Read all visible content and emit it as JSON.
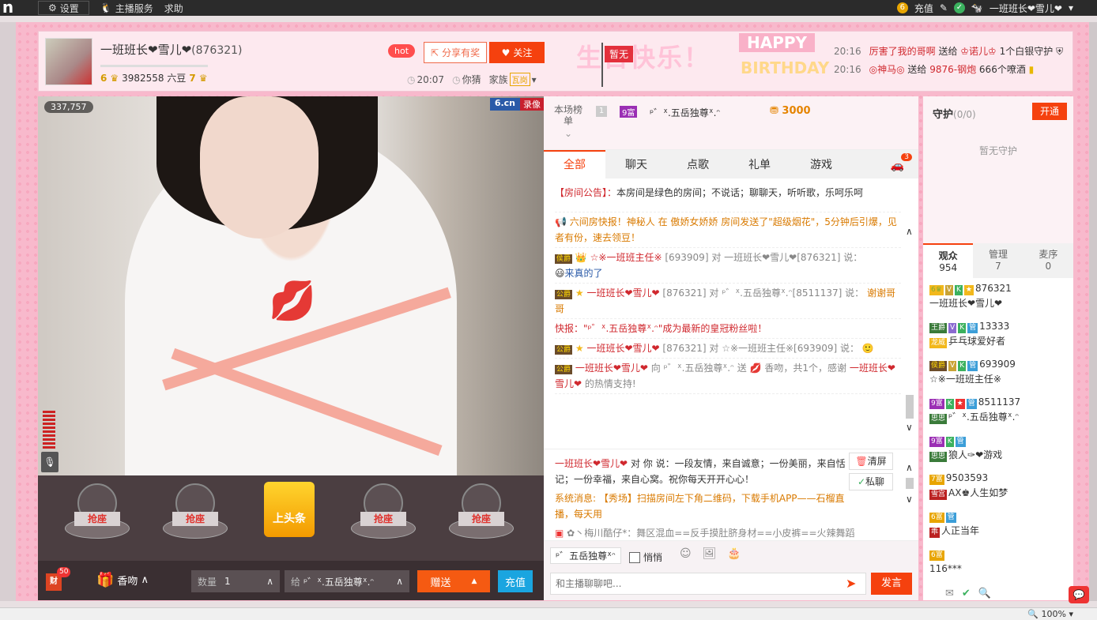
{
  "topbar": {
    "logo": "n",
    "settings": "设置",
    "anchor_service": "主播服务",
    "help": "求助",
    "coin_badge": "6",
    "recharge": "充值",
    "username": "一班班长❤雪儿❤"
  },
  "header": {
    "anchor_name": "一班班长❤雪儿❤",
    "anchor_id": "(876321)",
    "level_left": "6",
    "beans": "3982558 六豆",
    "level_right": "7",
    "hot": "hot",
    "share": "分享有奖",
    "follow": "关注",
    "time": "20:07",
    "guess": "你猜",
    "family_label": "家族",
    "family_badge": "瓦岗",
    "birthday_zh": "生日快乐！",
    "birthday_en1": "HAPPY",
    "birthday_en2": "BIRTHDAY",
    "flag": "暂无",
    "notices": [
      {
        "time": "20:16",
        "from": "厉害了我的哥啊",
        "verb": "送给",
        "to": "♔诺儿♔",
        "gift": "1个白银守护"
      },
      {
        "time": "20:16",
        "from": "◎神马◎",
        "verb": "送给",
        "to": "9876-钢炮",
        "gift": "666个嘹酒"
      }
    ]
  },
  "video": {
    "viewer_count": "337,757",
    "logo": "6.cn",
    "record": "录像"
  },
  "seats": {
    "grab": "抢座",
    "headline": "上头条"
  },
  "bottombar": {
    "gift_badge": "财",
    "gift_count": "50",
    "gift_name": "香吻",
    "qty_label": "数量",
    "qty_value": "1",
    "to_label": "给",
    "to_value": "ᵖ゛ᕽ.五岳独尊ᕽ.ᵔ",
    "send": "赠送",
    "recharge": "充值"
  },
  "chat": {
    "rank_label": "本场榜单",
    "rank_num": "1",
    "rank_level": "9富",
    "rank_name": "ᵖ゛ᕽ.五岳独尊ᕽ.ᵔ",
    "rank_coins": "3000",
    "tabs": [
      "全部",
      "聊天",
      "点歌",
      "礼单",
      "游戏"
    ],
    "car_count": "3",
    "messages": [
      {
        "a": "【房间公告】：",
        "b": "本房间是绿色的房间；不说话；聊聊天，听听歌，乐呵乐呵"
      },
      {
        "a": "六间房快报！神秘人 在 傲娇女娇娇 房间发送了\"超级烟花\"，5分钟后引爆，见者有份，速去领豆！",
        "b": ""
      },
      {
        "a": "☆※一班班主任※",
        "b": "[693909] 对 一班班长❤雪儿❤[876321] 说：",
        "c": "来真的了"
      },
      {
        "a": "一班班长❤雪儿❤",
        "b": "[876321] 对 ᵖ゛ᕽ.五岳独尊ᕽ.ᵔ[8511137] 说：",
        "c": "谢谢哥哥"
      },
      {
        "a": "快报：\"ᵖ゛ᕽ.五岳独尊ᕽ.ᵔ\"成为最新的皇冠粉丝啦！",
        "b": ""
      },
      {
        "a": "一班班长❤雪儿❤",
        "b": "[876321] 对 ☆※一班班主任※[693909] 说："
      },
      {
        "a": "一班班长❤雪儿❤",
        "b": "向 ᵖ゛ᕽ.五岳独尊ᕽ.ᵔ 送",
        "c": "香吻，共1个，感谢",
        "d": "一班班长❤雪儿❤",
        "e": "的热情支持!"
      }
    ],
    "lower": [
      {
        "a": "一班班长❤雪儿❤",
        "b": "对 你 说：一段友情，来自诚意；一份美丽，来自恬记；一份幸福，来自心窝。祝你每天开开心心！"
      },
      {
        "a": "系统消息: 【秀场】扫描房间左下角二维码，下载手机APP——石榴直播，每天用",
        "b": ""
      },
      {
        "a": "✿丶梅川酷仔*：舞区混血==反手摸肚脐身材==小皮裤==火辣舞蹈",
        "b": ""
      }
    ],
    "clear": "清屏",
    "private": "私聊",
    "target": "ᵖ゛五岳独尊ᕽᵔ",
    "quiet": "悄悄",
    "placeholder": "和主播聊聊吧...",
    "send": "发言"
  },
  "side": {
    "guard_title": "守护",
    "guard_count": "(0/0)",
    "open": "开通",
    "no_guard": "暂无守护",
    "tabs": [
      {
        "label": "观众",
        "count": "954"
      },
      {
        "label": "管理",
        "count": "7"
      },
      {
        "label": "麦序",
        "count": "0"
      }
    ],
    "audience": [
      {
        "id": "876321",
        "name": "一班班长❤雪儿❤"
      },
      {
        "id": "13333",
        "name": "乒乓球爱好者"
      },
      {
        "id": "693909",
        "name": "☆※一班班主任※"
      },
      {
        "id": "8511137",
        "name": "ᵖ゛ᕽ.五岳独尊ᕽ.ᵔ"
      },
      {
        "id": "",
        "name": "狼人✑❤游戏"
      },
      {
        "id": "9503593",
        "name": "AX♚人生如梦"
      },
      {
        "id": "",
        "name": "人正当年"
      },
      {
        "id": "",
        "name": "116***"
      }
    ]
  },
  "status": {
    "zoom": "100%"
  }
}
